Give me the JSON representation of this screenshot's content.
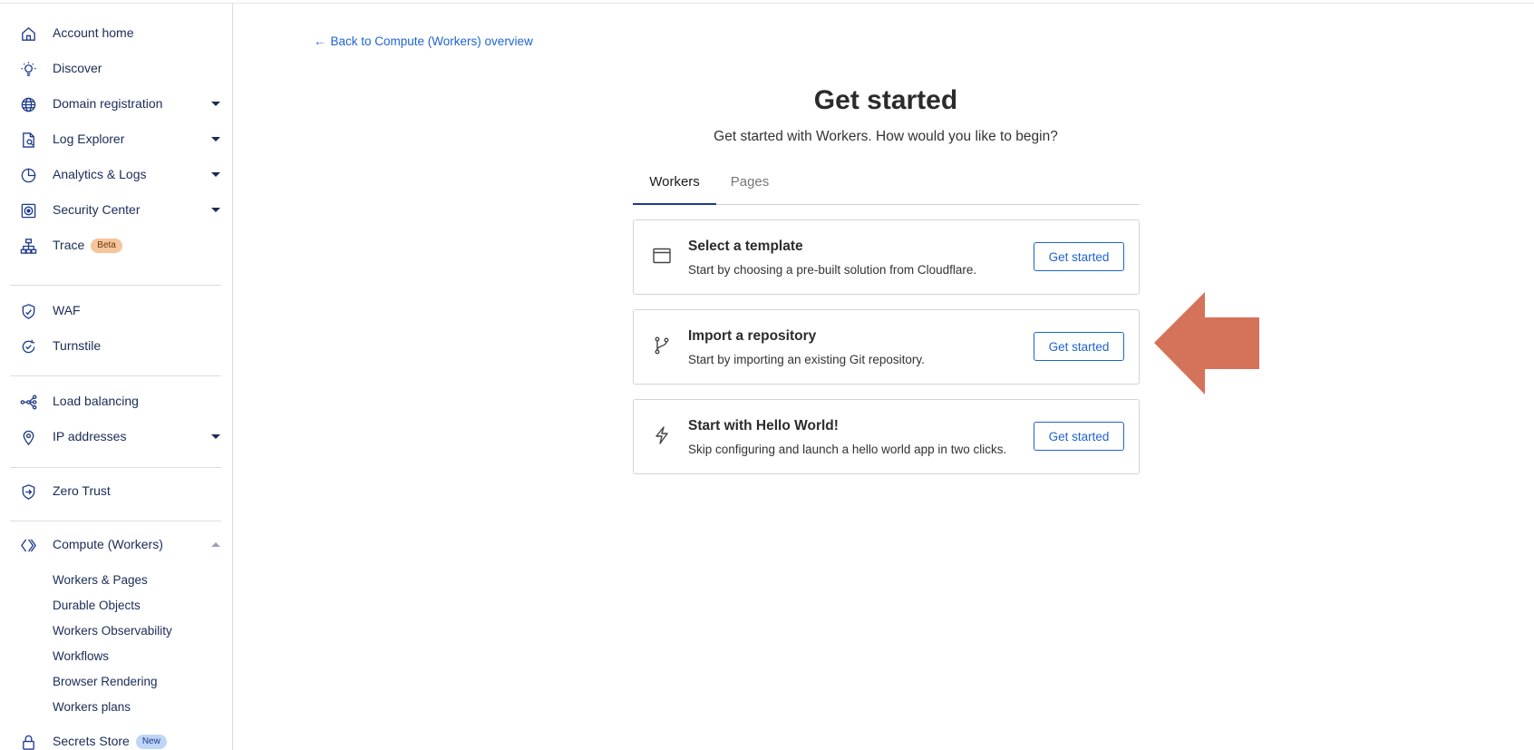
{
  "sidebar": {
    "items": [
      {
        "label": "Account home",
        "icon": "home-icon"
      },
      {
        "label": "Discover",
        "icon": "lightbulb-icon"
      },
      {
        "label": "Domain registration",
        "icon": "globe-icon"
      },
      {
        "label": "Log Explorer",
        "icon": "log-file-icon"
      },
      {
        "label": "Analytics & Logs",
        "icon": "pie-chart-icon"
      },
      {
        "label": "Security Center",
        "icon": "security-center-icon"
      },
      {
        "label": "Trace",
        "icon": "trace-icon",
        "badge": "Beta"
      },
      {
        "label": "WAF",
        "icon": "waf-shield-icon"
      },
      {
        "label": "Turnstile",
        "icon": "turnstile-icon"
      },
      {
        "label": "Load balancing",
        "icon": "load-balancer-icon"
      },
      {
        "label": "IP addresses",
        "icon": "location-pin-icon"
      },
      {
        "label": "Zero Trust",
        "icon": "zero-trust-icon"
      },
      {
        "label": "Compute (Workers)",
        "icon": "workers-icon"
      },
      {
        "label": "Secrets Store",
        "icon": "lock-icon",
        "badge": "New"
      }
    ],
    "compute_sub_items": [
      "Workers & Pages",
      "Durable Objects",
      "Workers Observability",
      "Workflows",
      "Browser Rendering",
      "Workers plans"
    ]
  },
  "main": {
    "back_link": "Back to Compute (Workers) overview",
    "title": "Get started",
    "subtitle": "Get started with Workers. How would you like to begin?",
    "tabs": [
      {
        "label": "Workers",
        "active": true
      },
      {
        "label": "Pages",
        "active": false
      }
    ],
    "cards": [
      {
        "title": "Select a template",
        "description": "Start by choosing a pre-built solution from Cloudflare.",
        "button": "Get started",
        "icon": "browser-window-icon"
      },
      {
        "title": "Import a repository",
        "description": "Start by importing an existing Git repository.",
        "button": "Get started",
        "icon": "git-branch-icon"
      },
      {
        "title": "Start with Hello World!",
        "description": "Skip configuring and launch a hello world app in two clicks.",
        "button": "Get started",
        "icon": "lightning-icon"
      }
    ]
  },
  "colors": {
    "accent": "#1f63d1",
    "nav_text": "#1a2b56",
    "annotation_arrow": "#d4735a"
  }
}
